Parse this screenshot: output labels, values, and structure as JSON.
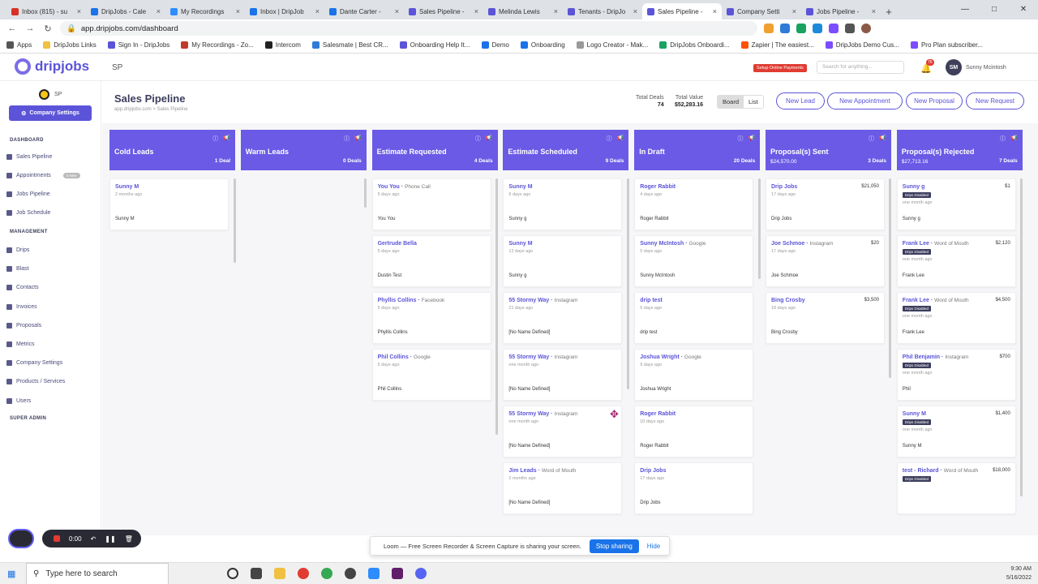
{
  "browser_tabs": [
    "Inbox (815) - su",
    "DripJobs - Cale",
    "My Recordings",
    "Inbox | DripJob",
    "Dante Carter - ",
    "Sales Pipeline -",
    "Melinda Lewis",
    "Tenants - DripJo",
    "Sales Pipeline -",
    "Company Setti",
    "Jobs Pipeline -"
  ],
  "address": {
    "url": "app.dripjobs.com/dashboard"
  },
  "bookmarks": [
    "Apps",
    "DripJobs Links",
    "Sign In - DripJobs",
    "My Recordings - Zo...",
    "Intercom",
    "Salesmate | Best CR...",
    "Onboarding Help It...",
    "Demo",
    "Onboarding",
    "Logo Creator - Mak...",
    "DripJobs Onboardi...",
    "Zapier | The easiest...",
    "DripJobs Demo Cus...",
    "Pro Plan subscriber..."
  ],
  "header": {
    "logo": "dripjobs",
    "workspace": "SP",
    "setup_payments": "Setup Online Payments",
    "search_placeholder": "Search for anything...",
    "notif_count": "76",
    "avatar_initials": "SM",
    "user_name": "Sunny Mcintosh"
  },
  "sidebar": {
    "org": "SP",
    "company_button": "Company Settings",
    "dashboard_label": "DASHBOARD",
    "dash_items": [
      "Sales Pipeline",
      "Appointments",
      "Jobs Pipeline",
      "Job Schedule"
    ],
    "appointments_badge": "0 New",
    "management_label": "MANAGEMENT",
    "mgmt_items": [
      "Drips",
      "Blast",
      "Contacts",
      "Invoices",
      "Proposals",
      "Metrics",
      "Company Settings",
      "Products / Services",
      "Users"
    ],
    "super_label": "SUPER ADMIN"
  },
  "page": {
    "title": "Sales Pipeline",
    "crumb": "app.dripjobs.com  >  Sales Pipeline",
    "total_deals_label": "Total Deals",
    "total_deals": "74",
    "total_value_label": "Total Value",
    "total_value": "$52,283.16",
    "view_board": "Board",
    "view_list": "List",
    "actions": [
      "New Lead",
      "New Appointment",
      "New Proposal",
      "New Request"
    ]
  },
  "columns": [
    {
      "name": "Cold Leads",
      "deals": "1 Deal",
      "value": "",
      "cards": [
        {
          "name": "Sunny M",
          "source": "",
          "age": "2 months ago",
          "person": "Sunny M",
          "amount": "",
          "badge": ""
        }
      ]
    },
    {
      "name": "Warm Leads",
      "deals": "0 Deals",
      "value": "",
      "cards": []
    },
    {
      "name": "Estimate Requested",
      "deals": "4 Deals",
      "value": "",
      "cards": [
        {
          "name": "You You",
          "source": "Phone Call",
          "age": "5 days ago",
          "person": "You You",
          "amount": "",
          "badge": ""
        },
        {
          "name": "Gertrude Bella",
          "source": "",
          "age": "5 days ago",
          "person": "Dustin Test",
          "amount": "",
          "badge": ""
        },
        {
          "name": "Phyllis Collins",
          "source": "Facebook",
          "age": "5 days ago",
          "person": "Phyllis Collins",
          "amount": "",
          "badge": ""
        },
        {
          "name": "Phil Collins",
          "source": "Google",
          "age": "5 days ago",
          "person": "Phil Collins",
          "amount": "",
          "badge": ""
        }
      ]
    },
    {
      "name": "Estimate Scheduled",
      "deals": "9 Deals",
      "value": "",
      "cards": [
        {
          "name": "Sunny M",
          "source": "",
          "age": "6 days ago",
          "person": "Sunny g",
          "amount": "",
          "badge": ""
        },
        {
          "name": "Sunny M",
          "source": "",
          "age": "12 days ago",
          "person": "Sunny g",
          "amount": "",
          "badge": ""
        },
        {
          "name": "55 Stormy Way",
          "source": "Instagram",
          "age": "21 days ago",
          "person": "[No Name Defined]",
          "amount": "",
          "badge": ""
        },
        {
          "name": "55 Stormy Way",
          "source": "Instagram",
          "age": "one month ago",
          "person": "[No Name Defined]",
          "amount": "",
          "badge": ""
        },
        {
          "name": "55 Stormy Way",
          "source": "Instagram",
          "age": "one month ago",
          "person": "[No Name Defined]",
          "amount": "",
          "badge": ""
        },
        {
          "name": "Jim Leads",
          "source": "Word of Mouth",
          "age": "2 months ago",
          "person": "[No Name Defined]",
          "amount": "",
          "badge": ""
        }
      ]
    },
    {
      "name": "In Draft",
      "deals": "20 Deals",
      "value": "",
      "cards": [
        {
          "name": "Roger Rabbit",
          "source": "",
          "age": "4 days ago",
          "person": "Roger Rabbit",
          "amount": "",
          "badge": ""
        },
        {
          "name": "Sunny McIntosh",
          "source": "Google",
          "age": "5 days ago",
          "person": "Sunny McIntosh",
          "amount": "",
          "badge": ""
        },
        {
          "name": "drip test",
          "source": "",
          "age": "6 days ago",
          "person": "drip test",
          "amount": "",
          "badge": ""
        },
        {
          "name": "Joshua Wright",
          "source": "Google",
          "age": "9 days ago",
          "person": "Joshua Wright",
          "amount": "",
          "badge": ""
        },
        {
          "name": "Roger Rabbit",
          "source": "",
          "age": "10 days ago",
          "person": "Roger Rabbit",
          "amount": "",
          "badge": ""
        },
        {
          "name": "Drip Jobs",
          "source": "",
          "age": "17 days ago",
          "person": "Drip Jobs",
          "amount": "",
          "badge": ""
        }
      ]
    },
    {
      "name": "Proposal(s) Sent",
      "deals": "3 Deals",
      "value": "$24,570.00",
      "cards": [
        {
          "name": "Drip Jobs",
          "source": "",
          "age": "17 days ago",
          "person": "Drip Jobs",
          "amount": "$21,050",
          "badge": ""
        },
        {
          "name": "Joe Schmoe",
          "source": "Instagram",
          "age": "17 days ago",
          "person": "Joe Schmoe",
          "amount": "$20",
          "badge": ""
        },
        {
          "name": "Bing Crosby",
          "source": "",
          "age": "18 days ago",
          "person": "Bing Crosby",
          "amount": "$3,500",
          "badge": ""
        }
      ]
    },
    {
      "name": "Proposal(s) Rejected",
      "deals": "7 Deals",
      "value": "$27,713.16",
      "cards": [
        {
          "name": "Sunny g",
          "source": "",
          "age": "one month ago",
          "person": "Sunny g",
          "amount": "$1",
          "badge": "Drips Disabled"
        },
        {
          "name": "Frank Lee",
          "source": "Word of Mouth",
          "age": "one month ago",
          "person": "Frank Lee",
          "amount": "$2,120",
          "badge": "Drips Disabled"
        },
        {
          "name": "Frank Lee",
          "source": "Word of Mouth",
          "age": "one month ago",
          "person": "Frank Lee",
          "amount": "$4,500",
          "badge": "Drips Disabled"
        },
        {
          "name": "Phil Benjamin",
          "source": "Instagram",
          "age": "one month ago",
          "person": "Phil",
          "amount": "$700",
          "badge": "Drips Disabled"
        },
        {
          "name": "Sunny M",
          "source": "",
          "age": "one month ago",
          "person": "Sunny M",
          "amount": "$1,400",
          "badge": "Drips Disabled"
        },
        {
          "name": "test - Richard",
          "source": "Word of Mouth",
          "age": "",
          "person": "",
          "amount": "$18,000",
          "badge": "Drips Disabled"
        }
      ]
    }
  ],
  "loom": {
    "timer": "0:00",
    "share_text": "Loom — Free Screen Recorder & Screen Capture is sharing your screen.",
    "stop": "Stop sharing",
    "hide": "Hide"
  },
  "taskbar": {
    "search_placeholder": "Type here to search",
    "time": "9:30 AM",
    "date": "5/16/2022"
  },
  "colors": {
    "accent": "#6a5ae6",
    "brand": "#5b54d8",
    "danger": "#e03c31"
  }
}
